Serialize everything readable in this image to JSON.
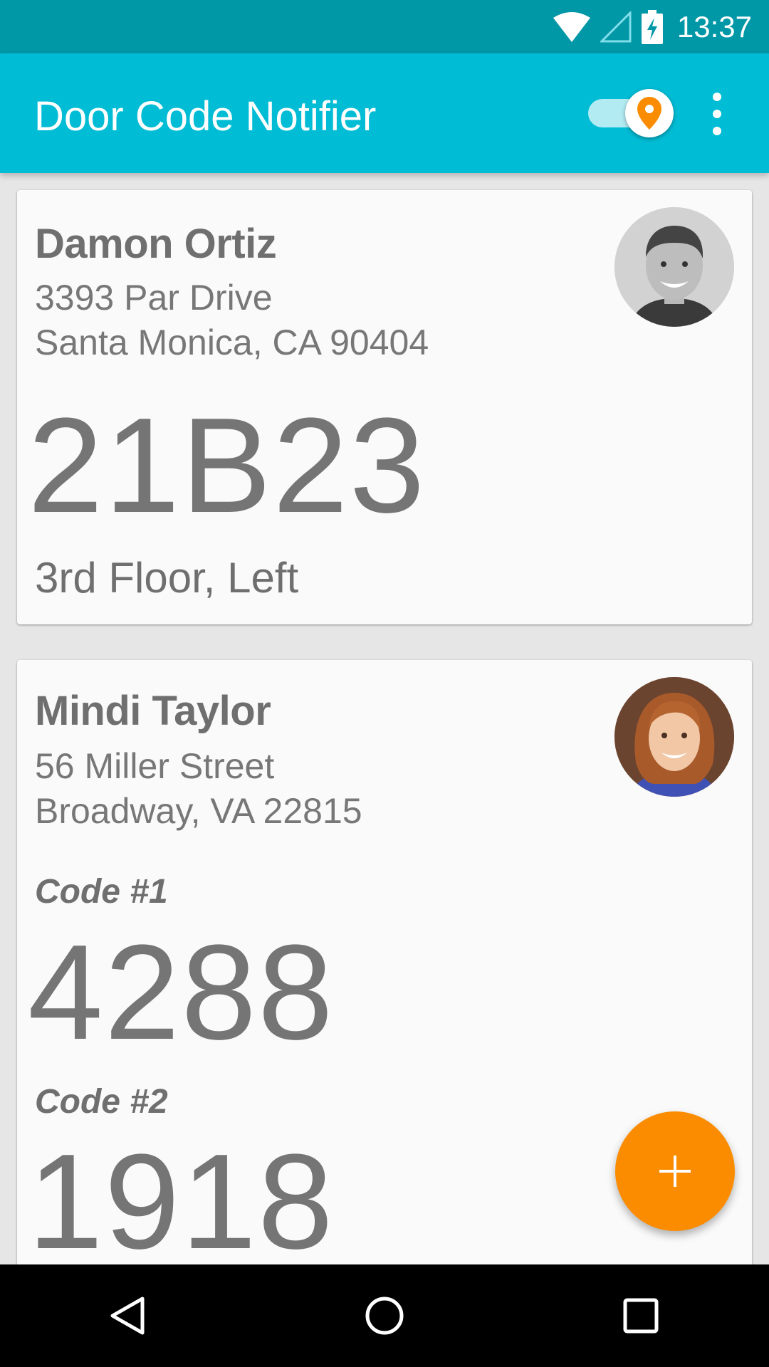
{
  "status_bar": {
    "time": "13:37",
    "icons": [
      "wifi-icon",
      "cell-signal-icon",
      "battery-charging-icon"
    ]
  },
  "app_bar": {
    "title": "Door Code Notifier",
    "location_toggle_on": true,
    "icons": [
      "location-pin-icon",
      "overflow-menu-icon"
    ]
  },
  "colors": {
    "primary": "#00bcd4",
    "primary_dark": "#0097a7",
    "accent": "#fb8c00",
    "card_text": "#757575"
  },
  "cards": [
    {
      "name": "Damon Ortiz",
      "address_line1": "3393 Par Drive",
      "address_line2": "Santa Monica, CA 90404",
      "code": "21B23",
      "note": "3rd Floor, Left",
      "avatar": "avatar-man-photo"
    },
    {
      "name": "Mindi Taylor",
      "address_line1": "56 Miller Street",
      "address_line2": "Broadway, VA 22815",
      "codes": [
        {
          "label": "Code #1",
          "value": "4288"
        },
        {
          "label": "Code #2",
          "value": "1918"
        }
      ],
      "avatar": "avatar-woman-photo"
    }
  ],
  "fab": {
    "icon": "plus-icon"
  },
  "nav_bar": {
    "icons": [
      "back-icon",
      "home-icon",
      "recents-icon"
    ]
  }
}
